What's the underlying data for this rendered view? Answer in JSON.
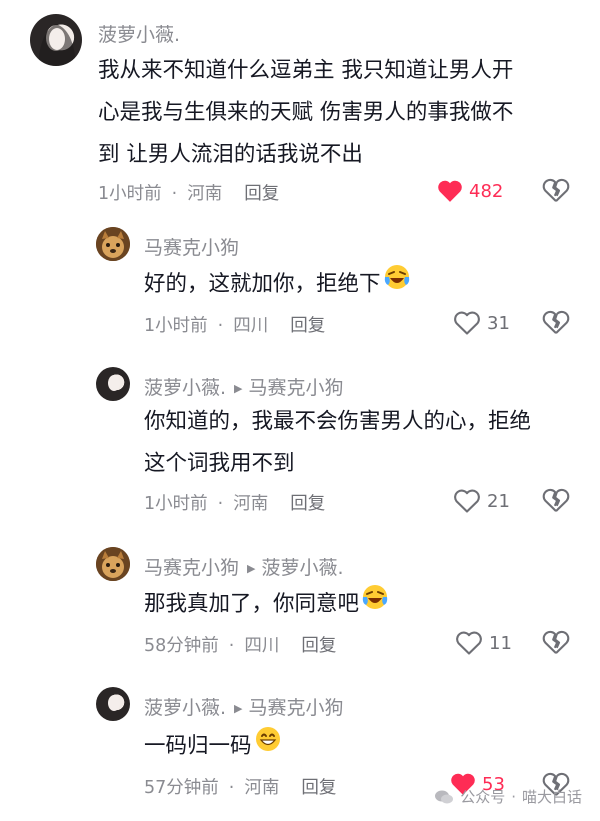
{
  "comments": [
    {
      "user": "菠萝小薇.",
      "text_lines": [
        "我从来不知道什么逗弟主 我只知道让男人开",
        "心是我与生俱来的天赋  伤害男人的事我做不",
        "到 让男人流泪的话我说不出"
      ],
      "time": "1小时前",
      "location": "河南",
      "reply_label": "回复",
      "likes": "482",
      "liked": true
    },
    {
      "user": "马赛克小狗",
      "text": "好的，这就加你，拒绝下",
      "emoji": "crying-laughing-emoji",
      "time": "1小时前",
      "location": "四川",
      "reply_label": "回复",
      "likes": "31",
      "liked": false
    },
    {
      "user": "菠萝小薇.",
      "reply_to": "马赛克小狗",
      "text_lines": [
        "你知道的，我最不会伤害男人的心，拒绝",
        "这个词我用不到"
      ],
      "time": "1小时前",
      "location": "河南",
      "reply_label": "回复",
      "likes": "21",
      "liked": false
    },
    {
      "user": "马赛克小狗",
      "reply_to": "菠萝小薇.",
      "text": "那我真加了，你同意吧",
      "emoji": "crying-laughing-emoji",
      "time": "58分钟前",
      "location": "四川",
      "reply_label": "回复",
      "likes": "11",
      "liked": false
    },
    {
      "user": "菠萝小薇.",
      "reply_to": "马赛克小狗",
      "text": "一码归一码",
      "emoji": "smiling-emoji",
      "time": "57分钟前",
      "location": "河南",
      "reply_label": "回复",
      "likes": "53",
      "liked": true
    }
  ],
  "watermark": {
    "left": "公众号",
    "right": "喵大白话"
  },
  "colors": {
    "like_red": "#fe2c55",
    "meta_gray": "#8a8b91",
    "text": "#161823"
  }
}
